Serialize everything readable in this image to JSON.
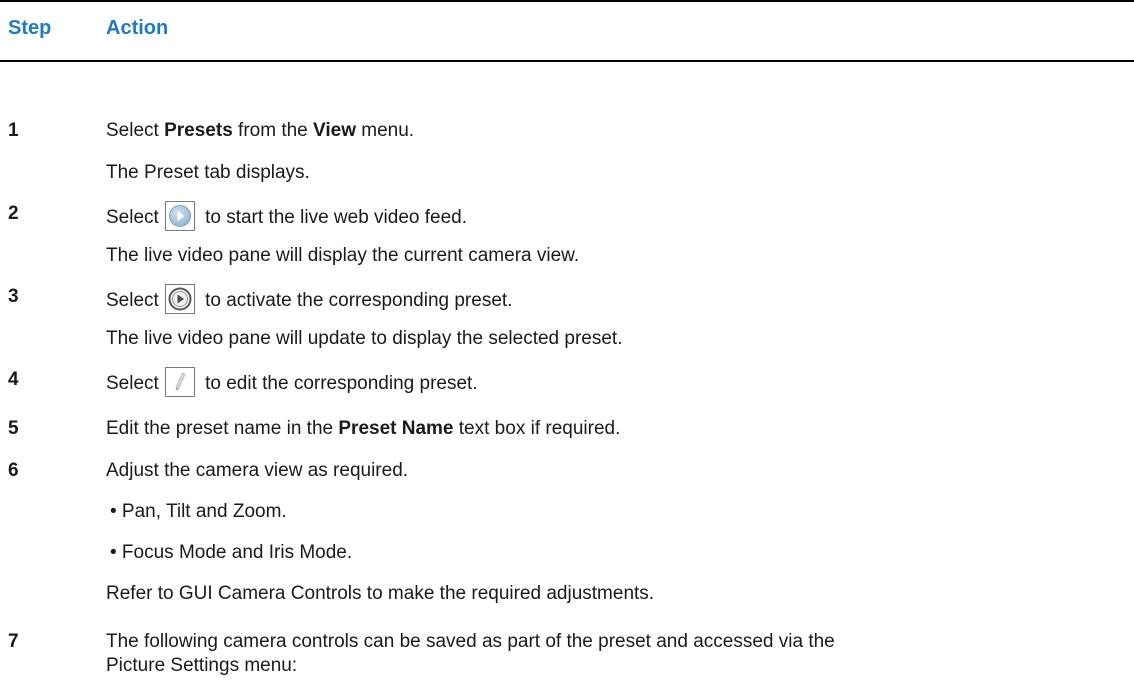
{
  "header": {
    "step": "Step",
    "action": "Action"
  },
  "steps": [
    {
      "num": "1",
      "l1_a": "Select ",
      "l1_b1": "Presets",
      "l1_c": " from the ",
      "l1_b2": "View",
      "l1_d": " menu.",
      "l2": "The Preset tab displays."
    },
    {
      "num": "2",
      "pre": "Select",
      "icon": "play-icon",
      "post": " to start the live web video feed.",
      "l2": "The live video pane will display the current camera view."
    },
    {
      "num": "3",
      "pre": "Select",
      "icon": "activate-preset-icon",
      "post": " to activate the corresponding preset.",
      "l2": "The live video pane will update to display the selected preset."
    },
    {
      "num": "4",
      "pre": "Select",
      "icon": "pencil-edit-icon",
      "post": " to edit the corresponding preset."
    },
    {
      "num": "5",
      "a": "Edit the preset name in the ",
      "b": "Preset Name",
      "c": " text box if required."
    },
    {
      "num": "6",
      "text": "Adjust the camera view as required.",
      "bullets": [
        "• Pan, Tilt and Zoom.",
        "• Focus Mode and Iris Mode."
      ],
      "refer": "Refer to  GUI Camera Controls to make the required adjustments."
    },
    {
      "num": "7",
      "l1": "The following camera controls can be saved as part of the preset and accessed via the",
      "l2": "Picture Settings menu:"
    }
  ]
}
